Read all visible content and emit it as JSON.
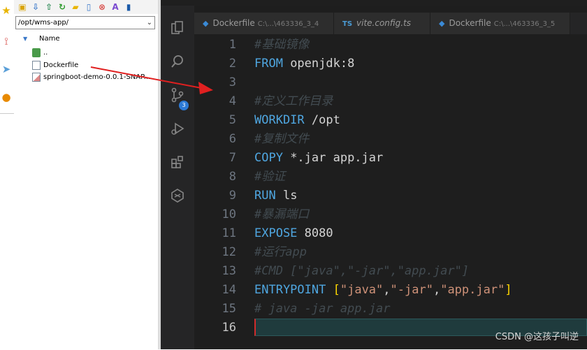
{
  "file_manager": {
    "path": "/opt/wms-app/",
    "column_header": "Name",
    "items": [
      {
        "name": "..",
        "type": "parent"
      },
      {
        "name": "Dockerfile",
        "type": "file"
      },
      {
        "name": "springboot-demo-0.0.1-SNAP...",
        "type": "jar"
      }
    ]
  },
  "vscode": {
    "source_control_badge": "3",
    "tabs": [
      {
        "name": "Dockerfile",
        "path": "C:\\...\\463336_3_4",
        "icon": "docker-icon"
      },
      {
        "name": "vite.config.ts",
        "path": "",
        "icon": "TS"
      },
      {
        "name": "Dockerfile",
        "path": "C:\\...\\463336_3_5",
        "icon": "docker-icon"
      }
    ],
    "lines": [
      {
        "n": "1",
        "parts": [
          {
            "t": "#基础镜像",
            "c": "cm"
          }
        ]
      },
      {
        "n": "2",
        "parts": [
          {
            "t": "FROM",
            "c": "kw"
          },
          {
            "t": " openjdk:8",
            "c": ""
          }
        ]
      },
      {
        "n": "3",
        "parts": []
      },
      {
        "n": "4",
        "parts": [
          {
            "t": "#定义工作目录",
            "c": "cm"
          }
        ]
      },
      {
        "n": "5",
        "parts": [
          {
            "t": "WORKDIR",
            "c": "kw"
          },
          {
            "t": " /opt",
            "c": ""
          }
        ]
      },
      {
        "n": "6",
        "parts": [
          {
            "t": "#复制文件",
            "c": "cm"
          }
        ]
      },
      {
        "n": "7",
        "parts": [
          {
            "t": "COPY",
            "c": "kw"
          },
          {
            "t": " *.jar app.jar",
            "c": ""
          }
        ]
      },
      {
        "n": "8",
        "parts": [
          {
            "t": "#验证",
            "c": "cm"
          }
        ]
      },
      {
        "n": "9",
        "parts": [
          {
            "t": "RUN",
            "c": "kw"
          },
          {
            "t": " ls",
            "c": ""
          }
        ]
      },
      {
        "n": "10",
        "parts": [
          {
            "t": "#暴漏端口",
            "c": "cm"
          }
        ]
      },
      {
        "n": "11",
        "parts": [
          {
            "t": "EXPOSE",
            "c": "kw"
          },
          {
            "t": " 8080",
            "c": ""
          }
        ]
      },
      {
        "n": "12",
        "parts": [
          {
            "t": "#运行app",
            "c": "cm"
          }
        ]
      },
      {
        "n": "13",
        "parts": [
          {
            "t": "#CMD [\"java\",\"-jar\",\"app.jar\"]",
            "c": "cm"
          }
        ]
      },
      {
        "n": "14",
        "parts": [
          {
            "t": "ENTRYPOINT",
            "c": "kw"
          },
          {
            "t": " ",
            "c": ""
          },
          {
            "t": "[",
            "c": "br"
          },
          {
            "t": "\"java\"",
            "c": "str"
          },
          {
            "t": ",",
            "c": ""
          },
          {
            "t": "\"-jar\"",
            "c": "str"
          },
          {
            "t": ",",
            "c": ""
          },
          {
            "t": "\"app.jar\"",
            "c": "str"
          },
          {
            "t": "]",
            "c": "br"
          }
        ]
      },
      {
        "n": "15",
        "parts": [
          {
            "t": "# java -jar app.jar",
            "c": "cm"
          }
        ]
      },
      {
        "n": "16",
        "parts": [],
        "active": true
      }
    ]
  },
  "watermark": "CSDN @这孩子叫逆"
}
